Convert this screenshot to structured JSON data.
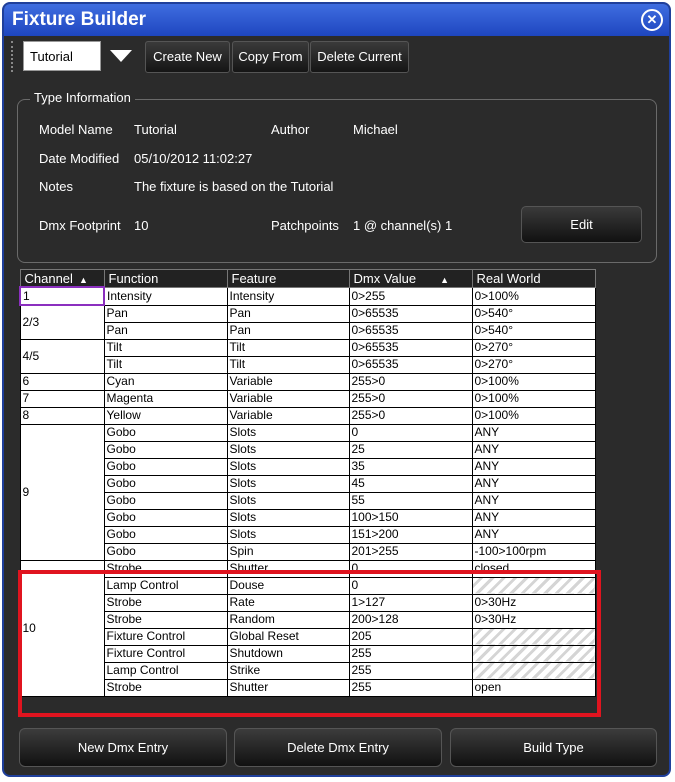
{
  "window": {
    "title": "Fixture Builder"
  },
  "toolbar": {
    "type_select_value": "Tutorial",
    "create_new": "Create New",
    "copy_from": "Copy From",
    "delete_current": "Delete Current"
  },
  "type_info": {
    "legend": "Type Information",
    "model_name_label": "Model Name",
    "model_name": "Tutorial",
    "author_label": "Author",
    "author": "Michael",
    "date_modified_label": "Date Modified",
    "date_modified": "05/10/2012 11:02:27",
    "notes_label": "Notes",
    "notes": "The fixture is based on the Tutorial",
    "dmx_footprint_label": "Dmx Footprint",
    "dmx_footprint": "10",
    "patchpoints_label": "Patchpoints",
    "patchpoints": "1 @ channel(s)  1",
    "edit_label": "Edit"
  },
  "table": {
    "headers": [
      "Channel",
      "Function",
      "Feature",
      "Dmx Value",
      "Real World"
    ],
    "rows": [
      {
        "channel": "1",
        "function": "Intensity",
        "feature": "Intensity",
        "dmx": "0>255",
        "real": "0>100%"
      },
      {
        "channel": "2/3",
        "function": "Pan",
        "feature": "Pan",
        "dmx": "0>65535",
        "real": "0>540°"
      },
      {
        "channel": "",
        "function": "Pan",
        "feature": "Pan",
        "dmx": "0>65535",
        "real": "0>540°"
      },
      {
        "channel": "4/5",
        "function": "Tilt",
        "feature": "Tilt",
        "dmx": "0>65535",
        "real": "0>270°"
      },
      {
        "channel": "",
        "function": "Tilt",
        "feature": "Tilt",
        "dmx": "0>65535",
        "real": "0>270°"
      },
      {
        "channel": "6",
        "function": "Cyan",
        "feature": "Variable",
        "dmx": "255>0",
        "real": "0>100%"
      },
      {
        "channel": "7",
        "function": "Magenta",
        "feature": "Variable",
        "dmx": "255>0",
        "real": "0>100%"
      },
      {
        "channel": "8",
        "function": "Yellow",
        "feature": "Variable",
        "dmx": "255>0",
        "real": "0>100%"
      },
      {
        "channel": "9",
        "function": "Gobo",
        "feature": "Slots",
        "dmx": "0",
        "real": "ANY"
      },
      {
        "channel": "",
        "function": "Gobo",
        "feature": "Slots",
        "dmx": "25",
        "real": "ANY"
      },
      {
        "channel": "",
        "function": "Gobo",
        "feature": "Slots",
        "dmx": "35",
        "real": "ANY"
      },
      {
        "channel": "",
        "function": "Gobo",
        "feature": "Slots",
        "dmx": "45",
        "real": "ANY"
      },
      {
        "channel": "",
        "function": "Gobo",
        "feature": "Slots",
        "dmx": "55",
        "real": "ANY"
      },
      {
        "channel": "",
        "function": "Gobo",
        "feature": "Slots",
        "dmx": "100>150",
        "real": "ANY"
      },
      {
        "channel": "",
        "function": "Gobo",
        "feature": "Slots",
        "dmx": "151>200",
        "real": "ANY"
      },
      {
        "channel": "",
        "function": "Gobo",
        "feature": "Spin",
        "dmx": "201>255",
        "real": "-100>100rpm"
      },
      {
        "channel": "10",
        "function": "Strobe",
        "feature": "Shutter",
        "dmx": "0",
        "real": "closed"
      },
      {
        "channel": "",
        "function": "Lamp Control",
        "feature": "Douse",
        "dmx": "0",
        "real": ""
      },
      {
        "channel": "",
        "function": "Strobe",
        "feature": "Rate",
        "dmx": "1>127",
        "real": "0>30Hz"
      },
      {
        "channel": "",
        "function": "Strobe",
        "feature": "Random",
        "dmx": "200>128",
        "real": "0>30Hz"
      },
      {
        "channel": "",
        "function": "Fixture Control",
        "feature": "Global Reset",
        "dmx": "205",
        "real": ""
      },
      {
        "channel": "",
        "function": "Fixture Control",
        "feature": "Shutdown",
        "dmx": "255",
        "real": ""
      },
      {
        "channel": "",
        "function": "Lamp Control",
        "feature": "Strike",
        "dmx": "255",
        "real": ""
      },
      {
        "channel": "",
        "function": "Strobe",
        "feature": "Shutter",
        "dmx": "255",
        "real": "open"
      }
    ]
  },
  "bottom": {
    "new_dmx_entry": "New Dmx Entry",
    "delete_dmx_entry": "Delete Dmx Entry",
    "build_type": "Build Type"
  },
  "colors": {
    "title_bar": "#2a55d2",
    "highlight_box": "#e0141f",
    "panel_bg": "#2b2b2b"
  }
}
